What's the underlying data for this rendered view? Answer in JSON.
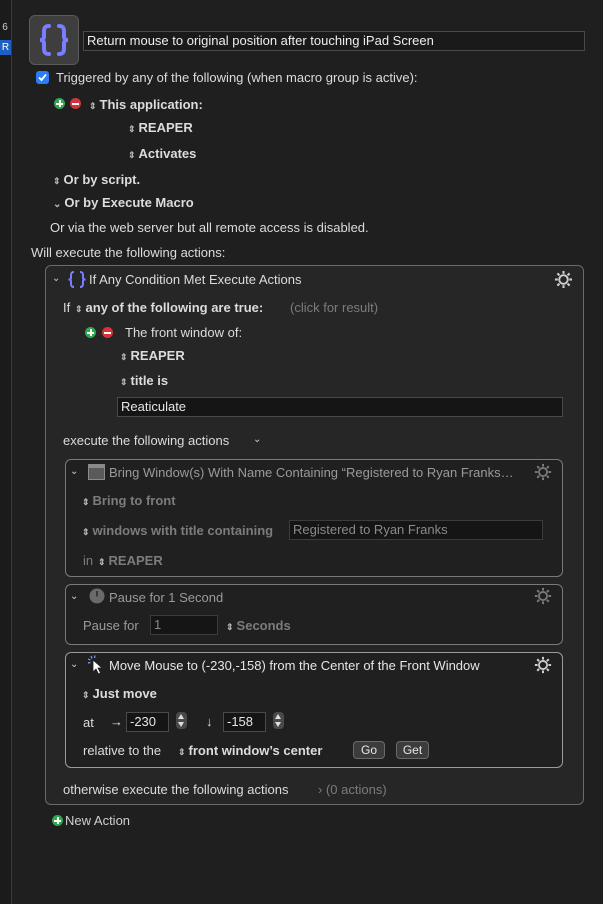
{
  "sidebar": {
    "number": "6",
    "selected": "R"
  },
  "macro": {
    "name": "Return mouse to original position after touching iPad Screen"
  },
  "triggers": {
    "header": "Triggered by any of the following (when macro group is active):",
    "app_label": "This application:",
    "app_name": "REAPER",
    "app_event": "Activates",
    "by_script": "Or by script.",
    "by_execute": "Or by Execute Macro",
    "web_server": "Or via the web server but all remote access is disabled."
  },
  "will_execute": "Will execute the following actions:",
  "if_action": {
    "title": "If Any Condition Met Execute Actions",
    "if_label": "If",
    "condition_mode": "any of the following are true:",
    "click_result": "(click for result)",
    "condition_title": "The front window of:",
    "condition_app": "REAPER",
    "condition_prop": "title is",
    "condition_value": "Reaticulate",
    "execute_label": "execute the following actions",
    "otherwise_label": "otherwise execute the following actions",
    "otherwise_count": "(0 actions)"
  },
  "actions": {
    "bring": {
      "title": "Bring Window(s) With Name Containing “Registered to Ryan Franks…",
      "mode": "Bring to front",
      "filter": "windows with title containing",
      "filter_value": "Registered to Ryan Franks",
      "in_label": "in",
      "app": "REAPER"
    },
    "pause": {
      "title": "Pause for 1 Second",
      "label": "Pause for",
      "value": "1",
      "unit": "Seconds"
    },
    "move": {
      "title": "Move Mouse to (-230,-158) from the Center of the Front Window",
      "mode": "Just move",
      "at_label": "at",
      "x_arrow": "→",
      "x_value": "-230",
      "y_arrow": "↓",
      "y_value": "-158",
      "relative_label": "relative to the",
      "relative_value": "front window’s center",
      "go": "Go",
      "get": "Get"
    }
  },
  "new_action": "New Action",
  "colors": {
    "accent": "#2c7cf6",
    "plus": "#2fa84f",
    "minus": "#d5333c",
    "macro_icon": "#7b7dff"
  },
  "icons": [
    "curly-braces-icon",
    "gear-icon",
    "window-icon",
    "clock-icon",
    "cursor-icon"
  ]
}
